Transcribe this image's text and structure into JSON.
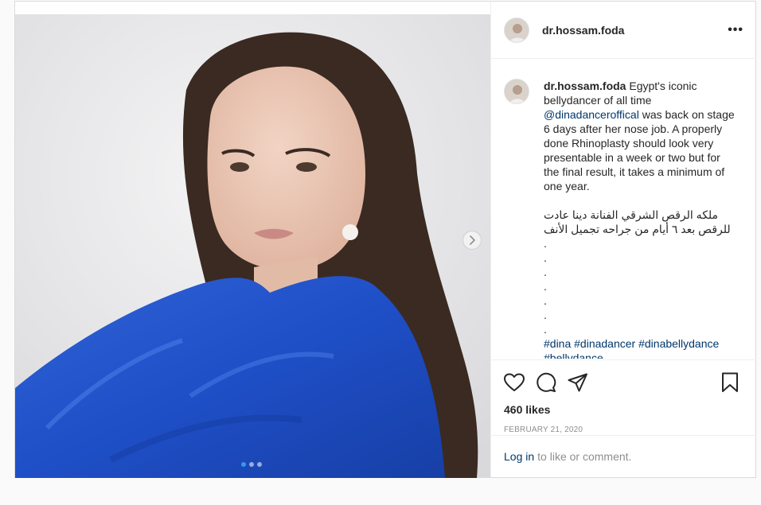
{
  "post": {
    "username": "dr.hossam.foda",
    "more_label": "•••",
    "caption": {
      "username": "dr.hossam.foda",
      "text_1": " Egypt's iconic bellydancer of all time ",
      "mention": "@dinadanceroffical",
      "text_2": " was back on stage 6 days after her nose job. A properly done Rhinoplasty should look very presentable in a week or two but for the final result, it takes a minimum of one year.",
      "arabic": "ملكه الرقص الشرقي الفنانة دينا عادت للرقص بعد ٦ أيام من جراحه تجميل الأنف",
      "dots": [
        ".",
        ".",
        ".",
        ".",
        ".",
        ".",
        "."
      ],
      "hashtags": "#dina #dinadancer #dinabellydance #bellydance"
    },
    "likes": "460 likes",
    "date": "FEBRUARY 21, 2020",
    "login_link": "Log in",
    "login_text": "to like or comment."
  },
  "carousel": {
    "current": 1,
    "total": 3
  },
  "colors": {
    "accent": "#3897f0",
    "link": "#00376b",
    "muted": "#8e8e8e",
    "border": "#dbdbdb"
  },
  "icons": [
    "heart-icon",
    "comment-icon",
    "share-icon",
    "save-icon",
    "chevron-right-icon",
    "more-icon"
  ]
}
